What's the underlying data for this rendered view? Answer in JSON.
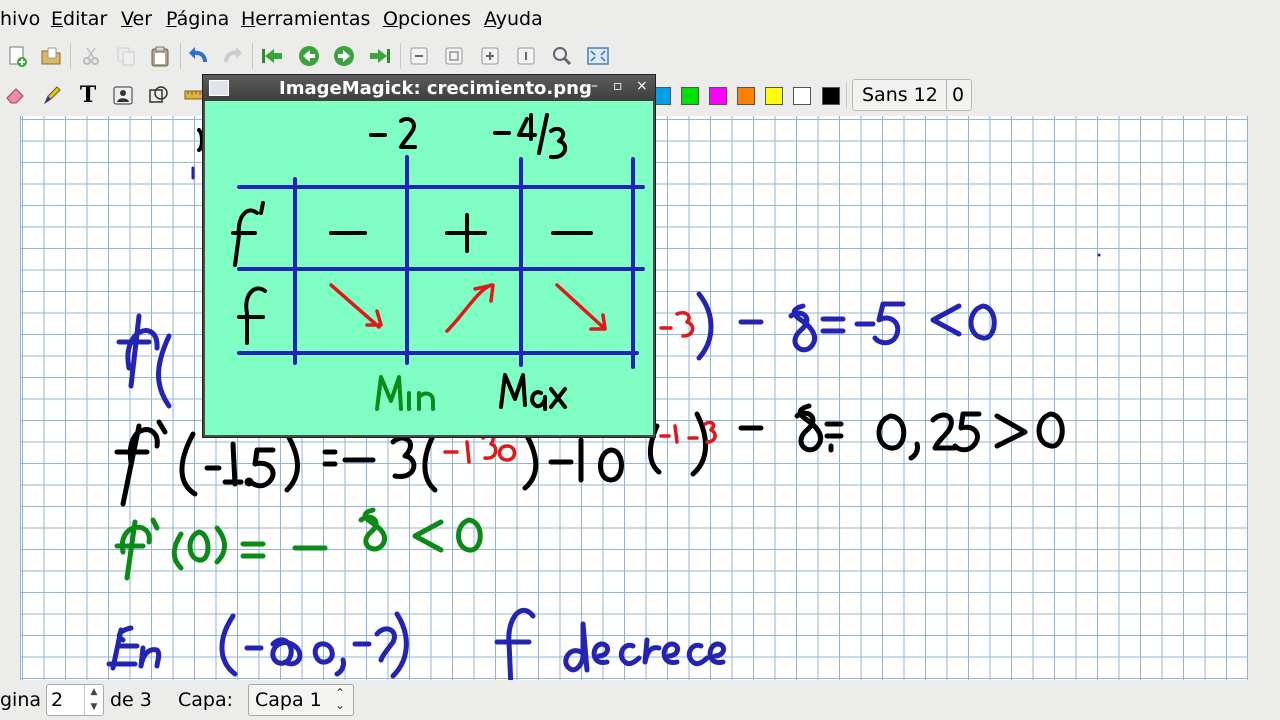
{
  "menu": {
    "items": [
      "hivo",
      "Editar",
      "Ver",
      "Página",
      "Herramientas",
      "Opciones",
      "Ayuda"
    ]
  },
  "toolbar1": {
    "icons": [
      "new-page-icon",
      "open-folder-icon",
      "cut-icon",
      "copy-icon",
      "paste-icon",
      "undo-icon",
      "redo-icon",
      "first-page-icon",
      "previous-page-icon",
      "next-page-icon",
      "last-page-icon",
      "zoom-out-icon",
      "zoom-fit-icon",
      "zoom-in-icon",
      "zoom-normal-icon",
      "zoom-icon",
      "fullscreen-icon"
    ]
  },
  "toolbar2": {
    "icons": [
      "eraser-icon",
      "pen-icon",
      "text-tool-icon",
      "image-tool-icon",
      "shape-tool-icon",
      "ruler-icon"
    ],
    "colors": [
      "#00a0e8",
      "#00e000",
      "#ff00ff",
      "#ff8000",
      "#ffff00",
      "#ffffff",
      "#000000"
    ],
    "font": "Sans 12",
    "font_extra": "0"
  },
  "image_window": {
    "title": "ImageMagick: crecimiento.png",
    "buttons": [
      "–",
      "▫",
      "×"
    ]
  },
  "drawing": {
    "table_top_labels": [
      "–2",
      "–4/3"
    ],
    "row_labels": [
      "f'",
      "f"
    ],
    "signs": [
      "–",
      "+",
      "–"
    ],
    "bottom_labels": [
      "Min",
      "Max"
    ],
    "line1": "f'(-3)= ... (-3) – 8 = –5 < 0",
    "line1_visible": "–3) – 8 = –5 < 0",
    "line2": "f'(-1.5) = –3(-1.5) – 10(-1.5) – 8 = 0,25 > 0",
    "line3": "f'(0) = – 8 < 0",
    "line4": "En (–∞, –2)   f decrece"
  },
  "statusbar": {
    "page_label": "gina",
    "page_value": "2",
    "page_of": "de 3",
    "layer_label": "Capa:",
    "layer_value": "Capa 1"
  }
}
